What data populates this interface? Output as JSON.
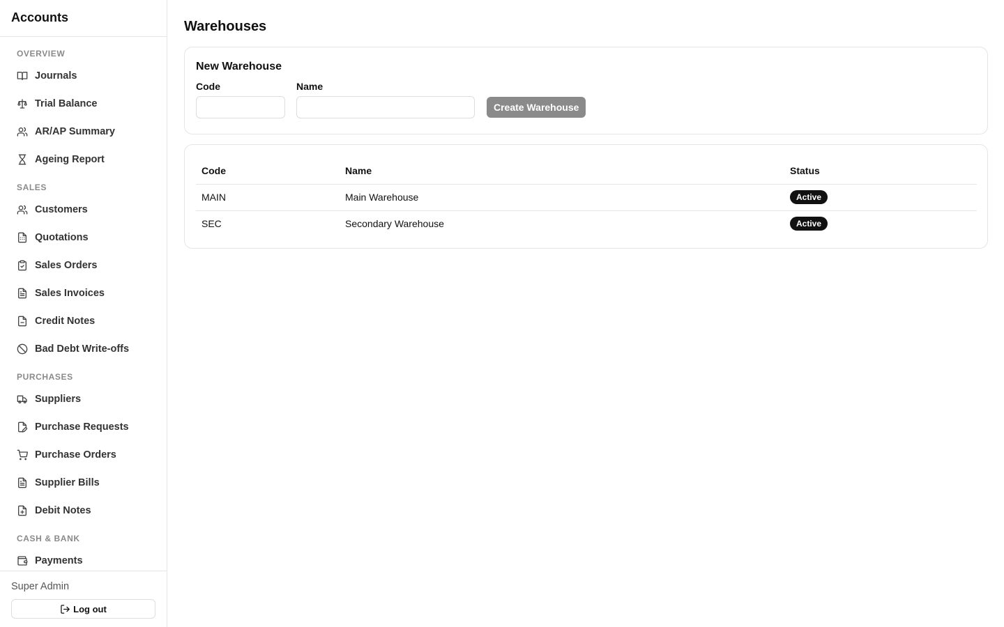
{
  "app": {
    "title": "Accounts"
  },
  "sidebar": {
    "sections": [
      {
        "title": "OVERVIEW",
        "items": [
          {
            "label": "Journals",
            "icon": "book-icon"
          },
          {
            "label": "Trial Balance",
            "icon": "scale-icon"
          },
          {
            "label": "AR/AP Summary",
            "icon": "users-icon"
          },
          {
            "label": "Ageing Report",
            "icon": "hourglass-icon"
          }
        ]
      },
      {
        "title": "SALES",
        "items": [
          {
            "label": "Customers",
            "icon": "users-icon"
          },
          {
            "label": "Quotations",
            "icon": "file-calculator-icon"
          },
          {
            "label": "Sales Orders",
            "icon": "clipboard-check-icon"
          },
          {
            "label": "Sales Invoices",
            "icon": "file-text-icon"
          },
          {
            "label": "Credit Notes",
            "icon": "file-minus-icon"
          },
          {
            "label": "Bad Debt Write-offs",
            "icon": "ban-icon"
          }
        ]
      },
      {
        "title": "PURCHASES",
        "items": [
          {
            "label": "Suppliers",
            "icon": "truck-icon"
          },
          {
            "label": "Purchase Requests",
            "icon": "file-pen-icon"
          },
          {
            "label": "Purchase Orders",
            "icon": "cart-icon"
          },
          {
            "label": "Supplier Bills",
            "icon": "file-text-icon"
          },
          {
            "label": "Debit Notes",
            "icon": "file-plus-icon"
          }
        ]
      },
      {
        "title": "CASH & BANK",
        "items": [
          {
            "label": "Payments",
            "icon": "wallet-icon"
          }
        ]
      }
    ],
    "footer": {
      "user": "Super Admin",
      "logout_label": "Log out"
    }
  },
  "main": {
    "title": "Warehouses",
    "form": {
      "title": "New Warehouse",
      "code_label": "Code",
      "code_value": "",
      "name_label": "Name",
      "name_value": "",
      "submit_label": "Create Warehouse"
    },
    "table": {
      "columns": [
        "Code",
        "Name",
        "Status"
      ],
      "rows": [
        {
          "code": "MAIN",
          "name": "Main Warehouse",
          "status": "Active"
        },
        {
          "code": "SEC",
          "name": "Secondary Warehouse",
          "status": "Active"
        }
      ]
    }
  }
}
